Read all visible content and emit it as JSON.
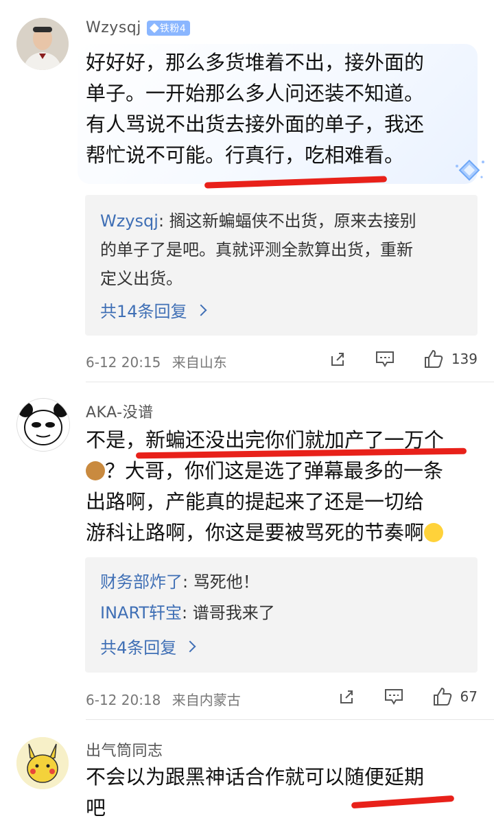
{
  "comments": [
    {
      "author": "Wzysqj",
      "badge": "铁粉4",
      "text_lines": [
        "好好好，那么多货堆着不出，接外面的",
        "单子。一开始那么多人问还装不知道。",
        "有人骂说不出货去接外面的单子，我还",
        "帮忙说不可能。行真行，吃相难看。"
      ],
      "replies": [
        {
          "name": "Wzysqj",
          "text_lines": [
            ": 搁这新蝙蝠侠不出货，原来去接别",
            "的单子了是吧。真就评测全款算出货，重新",
            "定义出货。"
          ]
        }
      ],
      "more_replies": "共14条回复",
      "time": "6-12 20:15",
      "location": "来自山东",
      "likes": "139"
    },
    {
      "author": "AKA-没谱",
      "text_lines": [
        "不是，新蝙还没出完你们就加产了一万个",
        "？大哥，你们这是选了弹幕最多的一条",
        "出路啊，产能真的提起来了还是一切给",
        "游科让路啊，你这是要被骂死的节奏啊"
      ],
      "replies": [
        {
          "name": "财务部炸了",
          "text": ": 骂死他！"
        },
        {
          "name": "INART轩宝",
          "text": ": 谱哥我来了"
        }
      ],
      "more_replies": "共4条回复",
      "time": "6-12 20:18",
      "location": "来自内蒙古",
      "likes": "67"
    },
    {
      "author": "出气筒同志",
      "text_lines": [
        "不会以为跟黑神话合作就可以随便延期",
        "吧"
      ]
    }
  ],
  "colors": {
    "accent_link": "#3f6fb5",
    "underline_red": "#e8211a",
    "badge_blue": "#8ab6ff",
    "reply_bg": "#f3f3f3"
  },
  "icons": [
    "share-icon",
    "comment-icon",
    "like-icon",
    "diamond-icon"
  ]
}
